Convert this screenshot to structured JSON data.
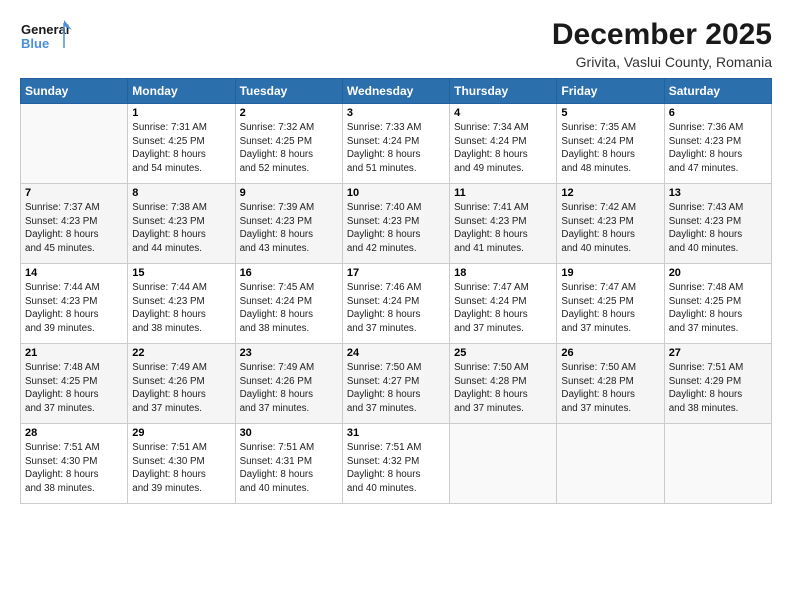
{
  "header": {
    "logo_line1": "General",
    "logo_line2": "Blue",
    "main_title": "December 2025",
    "subtitle": "Grivita, Vaslui County, Romania"
  },
  "days_of_week": [
    "Sunday",
    "Monday",
    "Tuesday",
    "Wednesday",
    "Thursday",
    "Friday",
    "Saturday"
  ],
  "weeks": [
    [
      {
        "day": "",
        "info": ""
      },
      {
        "day": "1",
        "info": "Sunrise: 7:31 AM\nSunset: 4:25 PM\nDaylight: 8 hours\nand 54 minutes."
      },
      {
        "day": "2",
        "info": "Sunrise: 7:32 AM\nSunset: 4:25 PM\nDaylight: 8 hours\nand 52 minutes."
      },
      {
        "day": "3",
        "info": "Sunrise: 7:33 AM\nSunset: 4:24 PM\nDaylight: 8 hours\nand 51 minutes."
      },
      {
        "day": "4",
        "info": "Sunrise: 7:34 AM\nSunset: 4:24 PM\nDaylight: 8 hours\nand 49 minutes."
      },
      {
        "day": "5",
        "info": "Sunrise: 7:35 AM\nSunset: 4:24 PM\nDaylight: 8 hours\nand 48 minutes."
      },
      {
        "day": "6",
        "info": "Sunrise: 7:36 AM\nSunset: 4:23 PM\nDaylight: 8 hours\nand 47 minutes."
      }
    ],
    [
      {
        "day": "7",
        "info": "Sunrise: 7:37 AM\nSunset: 4:23 PM\nDaylight: 8 hours\nand 45 minutes."
      },
      {
        "day": "8",
        "info": "Sunrise: 7:38 AM\nSunset: 4:23 PM\nDaylight: 8 hours\nand 44 minutes."
      },
      {
        "day": "9",
        "info": "Sunrise: 7:39 AM\nSunset: 4:23 PM\nDaylight: 8 hours\nand 43 minutes."
      },
      {
        "day": "10",
        "info": "Sunrise: 7:40 AM\nSunset: 4:23 PM\nDaylight: 8 hours\nand 42 minutes."
      },
      {
        "day": "11",
        "info": "Sunrise: 7:41 AM\nSunset: 4:23 PM\nDaylight: 8 hours\nand 41 minutes."
      },
      {
        "day": "12",
        "info": "Sunrise: 7:42 AM\nSunset: 4:23 PM\nDaylight: 8 hours\nand 40 minutes."
      },
      {
        "day": "13",
        "info": "Sunrise: 7:43 AM\nSunset: 4:23 PM\nDaylight: 8 hours\nand 40 minutes."
      }
    ],
    [
      {
        "day": "14",
        "info": "Sunrise: 7:44 AM\nSunset: 4:23 PM\nDaylight: 8 hours\nand 39 minutes."
      },
      {
        "day": "15",
        "info": "Sunrise: 7:44 AM\nSunset: 4:23 PM\nDaylight: 8 hours\nand 38 minutes."
      },
      {
        "day": "16",
        "info": "Sunrise: 7:45 AM\nSunset: 4:24 PM\nDaylight: 8 hours\nand 38 minutes."
      },
      {
        "day": "17",
        "info": "Sunrise: 7:46 AM\nSunset: 4:24 PM\nDaylight: 8 hours\nand 37 minutes."
      },
      {
        "day": "18",
        "info": "Sunrise: 7:47 AM\nSunset: 4:24 PM\nDaylight: 8 hours\nand 37 minutes."
      },
      {
        "day": "19",
        "info": "Sunrise: 7:47 AM\nSunset: 4:25 PM\nDaylight: 8 hours\nand 37 minutes."
      },
      {
        "day": "20",
        "info": "Sunrise: 7:48 AM\nSunset: 4:25 PM\nDaylight: 8 hours\nand 37 minutes."
      }
    ],
    [
      {
        "day": "21",
        "info": "Sunrise: 7:48 AM\nSunset: 4:25 PM\nDaylight: 8 hours\nand 37 minutes."
      },
      {
        "day": "22",
        "info": "Sunrise: 7:49 AM\nSunset: 4:26 PM\nDaylight: 8 hours\nand 37 minutes."
      },
      {
        "day": "23",
        "info": "Sunrise: 7:49 AM\nSunset: 4:26 PM\nDaylight: 8 hours\nand 37 minutes."
      },
      {
        "day": "24",
        "info": "Sunrise: 7:50 AM\nSunset: 4:27 PM\nDaylight: 8 hours\nand 37 minutes."
      },
      {
        "day": "25",
        "info": "Sunrise: 7:50 AM\nSunset: 4:28 PM\nDaylight: 8 hours\nand 37 minutes."
      },
      {
        "day": "26",
        "info": "Sunrise: 7:50 AM\nSunset: 4:28 PM\nDaylight: 8 hours\nand 37 minutes."
      },
      {
        "day": "27",
        "info": "Sunrise: 7:51 AM\nSunset: 4:29 PM\nDaylight: 8 hours\nand 38 minutes."
      }
    ],
    [
      {
        "day": "28",
        "info": "Sunrise: 7:51 AM\nSunset: 4:30 PM\nDaylight: 8 hours\nand 38 minutes."
      },
      {
        "day": "29",
        "info": "Sunrise: 7:51 AM\nSunset: 4:30 PM\nDaylight: 8 hours\nand 39 minutes."
      },
      {
        "day": "30",
        "info": "Sunrise: 7:51 AM\nSunset: 4:31 PM\nDaylight: 8 hours\nand 40 minutes."
      },
      {
        "day": "31",
        "info": "Sunrise: 7:51 AM\nSunset: 4:32 PM\nDaylight: 8 hours\nand 40 minutes."
      },
      {
        "day": "",
        "info": ""
      },
      {
        "day": "",
        "info": ""
      },
      {
        "day": "",
        "info": ""
      }
    ]
  ]
}
